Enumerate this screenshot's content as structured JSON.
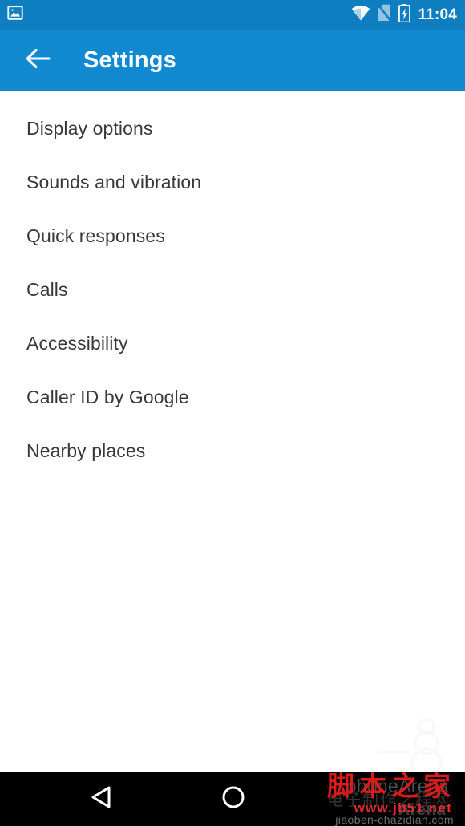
{
  "status_bar": {
    "background_color": "#0f7ec0",
    "time": "11:04",
    "notification_icon": "image-notification-icon",
    "icons": [
      {
        "name": "wifi-icon",
        "label": "Wi-Fi connected"
      },
      {
        "name": "no-sim-icon",
        "label": "No SIM card"
      },
      {
        "name": "battery-charging-icon",
        "label": "Battery charging"
      }
    ]
  },
  "app_bar": {
    "background_color": "#1089d0",
    "title": "Settings",
    "back_icon": "arrow-left-icon"
  },
  "settings_list": {
    "items": [
      {
        "label": "Display options"
      },
      {
        "label": "Sounds and vibration"
      },
      {
        "label": "Quick responses"
      },
      {
        "label": "Calls"
      },
      {
        "label": "Accessibility"
      },
      {
        "label": "Caller ID by Google"
      },
      {
        "label": "Nearby places"
      }
    ],
    "text_color": "#383838"
  },
  "watermarks": {
    "phonearena": "phoneArena",
    "phonearena_sub": "Arena",
    "chinese_site": "脚本之家",
    "chinese_site_alt": "电子制作之程网",
    "chinese_url": "www.jb51.net",
    "chinese_url_sub": "jiaoben-chazidian.com"
  },
  "nav_bar": {
    "background_color": "#000000",
    "buttons": [
      {
        "name": "nav-back-button",
        "icon": "triangle-back-icon"
      },
      {
        "name": "nav-home-button",
        "icon": "circle-home-icon"
      }
    ]
  }
}
